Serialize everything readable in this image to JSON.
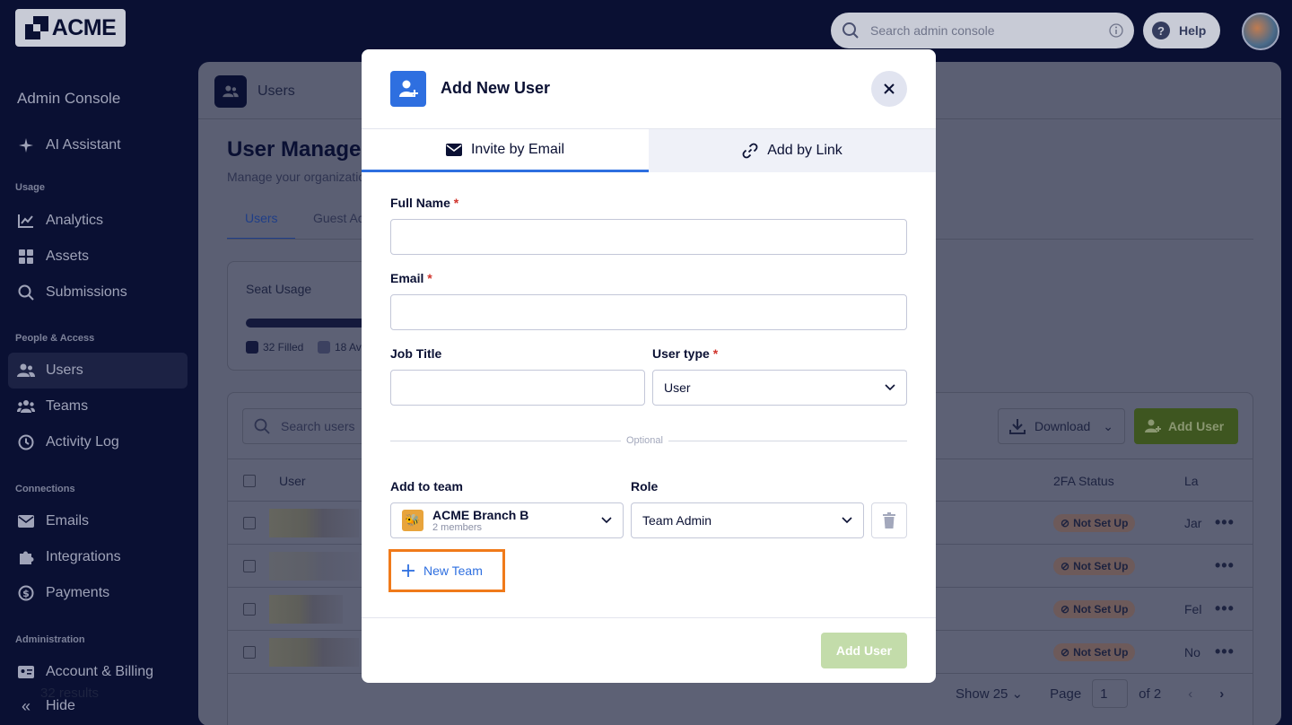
{
  "brand": {
    "logo_text": "ACME"
  },
  "topbar": {
    "search_placeholder": "Search admin console",
    "help_label": "Help"
  },
  "sidebar": {
    "title": "Admin Console",
    "ai_assistant": "AI Assistant",
    "sections": {
      "usage": "Usage",
      "people": "People & Access",
      "connections": "Connections",
      "administration": "Administration"
    },
    "items": {
      "analytics": "Analytics",
      "assets": "Assets",
      "submissions": "Submissions",
      "users": "Users",
      "teams": "Teams",
      "activity_log": "Activity Log",
      "emails": "Emails",
      "integrations": "Integrations",
      "payments": "Payments",
      "account_billing": "Account & Billing",
      "hide": "Hide"
    }
  },
  "main": {
    "header_title": "Users",
    "page_title": "User Managem",
    "page_subtitle": "Manage your organizatio",
    "tabs": {
      "users": "Users",
      "guest": "Guest Ac"
    },
    "seat_usage": {
      "title": "Seat Usage",
      "filled": "32 Filled",
      "available": "18 Av",
      "filled_count": 32,
      "available_count": 18
    },
    "table": {
      "search_placeholder": "Search users",
      "download_label": "Download",
      "add_user_label": "Add User",
      "columns": {
        "user": "User",
        "twofa": "2FA Status",
        "last": "La"
      },
      "rows": [
        {
          "twofa": "Not Set Up",
          "last": "Jar"
        },
        {
          "twofa": "Not Set Up",
          "last": ""
        },
        {
          "twofa": "Not Set Up",
          "last": "Fel"
        },
        {
          "twofa": "Not Set Up",
          "last": "No"
        }
      ],
      "results": "32 results",
      "show": "Show 25",
      "page_label": "Page",
      "page_value": "1",
      "page_of": "of 2"
    }
  },
  "modal": {
    "title": "Add New User",
    "tabs": {
      "email": "Invite by Email",
      "link": "Add by Link"
    },
    "fields": {
      "full_name_label": "Full Name",
      "email_label": "Email",
      "job_title_label": "Job Title",
      "user_type_label": "User type",
      "user_type_value": "User",
      "required_mark": "*"
    },
    "optional_label": "Optional",
    "team": {
      "add_to_team_label": "Add to team",
      "role_label": "Role",
      "team_name": "ACME Branch B",
      "team_members": "2 members",
      "role_value": "Team Admin",
      "new_team_label": "New Team"
    },
    "submit_label": "Add User"
  },
  "colors": {
    "background": "#0a1033",
    "accent_blue": "#2e6fe0",
    "highlight_orange": "#f07a1a",
    "add_user_disabled": "#c3dcaa",
    "required_red": "#d0342c"
  }
}
